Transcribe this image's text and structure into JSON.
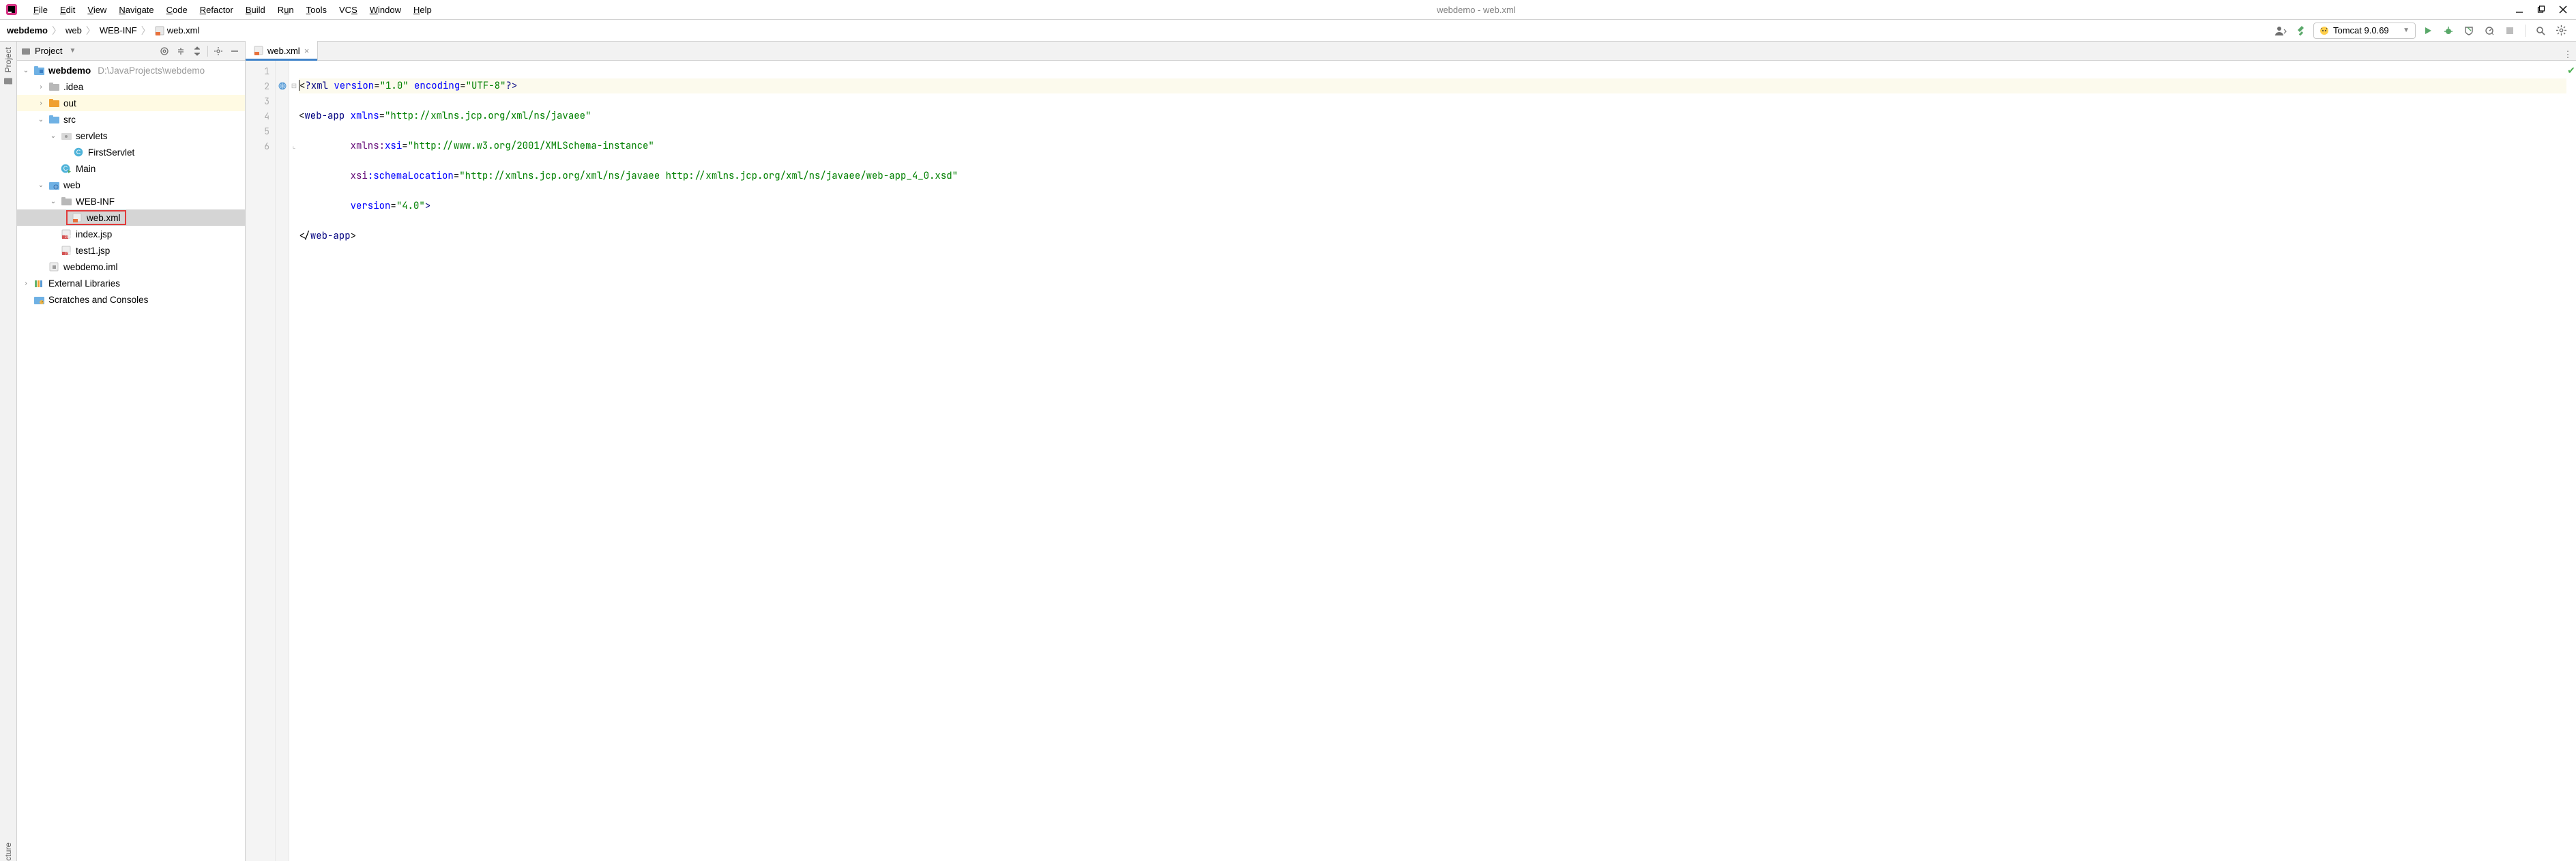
{
  "window_title": "webdemo - web.xml",
  "menus": [
    "File",
    "Edit",
    "View",
    "Navigate",
    "Code",
    "Refactor",
    "Build",
    "Run",
    "Tools",
    "VCS",
    "Window",
    "Help"
  ],
  "breadcrumbs": {
    "root": "webdemo",
    "parts": [
      "web",
      "WEB-INF",
      "web.xml"
    ]
  },
  "run_config": {
    "label": "Tomcat 9.0.69"
  },
  "project_panel": {
    "title": "Project",
    "root": {
      "name": "webdemo",
      "path": "D:\\JavaProjects\\webdemo"
    },
    "nodes": {
      "idea": ".idea",
      "out": "out",
      "src": "src",
      "servlets": "servlets",
      "first_servlet": "FirstServlet",
      "main": "Main",
      "web": "web",
      "web_inf": "WEB-INF",
      "web_xml": "web.xml",
      "index_jsp": "index.jsp",
      "test1_jsp": "test1.jsp",
      "iml": "webdemo.iml",
      "ext_libs": "External Libraries",
      "scratches": "Scratches and Consoles"
    }
  },
  "editor": {
    "tab_label": "web.xml",
    "lines": [
      "1",
      "2",
      "3",
      "4",
      "5",
      "6"
    ],
    "code": {
      "l1_a": "?xml ",
      "l1_b": "version",
      "l1_c": "=",
      "l1_d": "\"1.0\"",
      "l1_e": " encoding",
      "l1_f": "=",
      "l1_g": "\"UTF-8\"",
      "l1_h": "?>",
      "l2_a": "<",
      "l2_b": "web-app ",
      "l2_c": "xmlns",
      "l2_d": "=",
      "l2_e": "\"http://xmlns.jcp.org/xml/ns/javaee\"",
      "l3_a": "xmlns:",
      "l3_b": "xsi",
      "l3_c": "=",
      "l3_d": "\"http://www.w3.org/2001/XMLSchema-instance\"",
      "l4_a": "xsi",
      "l4_b": ":schemaLocation",
      "l4_c": "=",
      "l4_d": "\"http://xmlns.jcp.org/xml/ns/javaee http://xmlns.jcp.org/xml/ns/javaee/web-app_4_0.xsd\"",
      "l5_a": "version",
      "l5_b": "=",
      "l5_c": "\"4.0\"",
      "l5_d": ">",
      "l6_a": "</",
      "l6_b": "web-app",
      "l6_c": ">"
    }
  },
  "side_tabs": {
    "project": "Project",
    "structure": "cture"
  }
}
